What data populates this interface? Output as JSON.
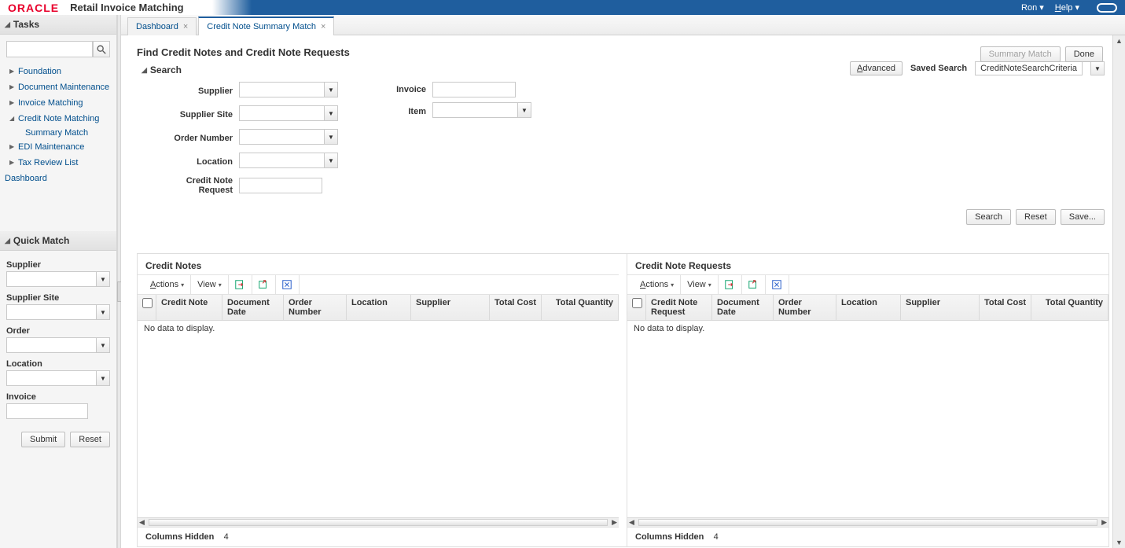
{
  "brand": {
    "logo": "ORACLE",
    "app": "Retail Invoice Matching",
    "user": "Ron",
    "help": "Help"
  },
  "sidebar": {
    "tasks_title": "Tasks",
    "tree": {
      "foundation": "Foundation",
      "doc_maint": "Document Maintenance",
      "inv_match": "Invoice Matching",
      "cn_match": "Credit Note Matching",
      "cn_summary": "Summary Match",
      "edi": "EDI Maintenance",
      "tax": "Tax Review List",
      "dashboard": "Dashboard"
    },
    "quick_match": {
      "title": "Quick Match",
      "supplier": "Supplier",
      "supplier_site": "Supplier Site",
      "order": "Order",
      "location": "Location",
      "invoice": "Invoice",
      "submit": "Submit",
      "reset": "Reset"
    }
  },
  "tabs": {
    "dashboard": "Dashboard",
    "cns": "Credit Note Summary Match"
  },
  "page": {
    "title": "Find Credit Notes and Credit Note Requests",
    "summary_btn": "Summary Match",
    "done_btn": "Done"
  },
  "search": {
    "title": "Search",
    "advanced": "Advanced",
    "advanced_key": "A",
    "saved_label": "Saved Search",
    "saved_value": "CreditNoteSearchCriteria",
    "fields": {
      "supplier": "Supplier",
      "supplier_site": "Supplier Site",
      "order_no": "Order Number",
      "location": "Location",
      "cnr": "Credit Note Request",
      "invoice": "Invoice",
      "item": "Item"
    },
    "buttons": {
      "search": "Search",
      "reset": "Reset",
      "save": "Save..."
    }
  },
  "toolbar": {
    "actions": "Actions",
    "actions_key": "A",
    "view": "View"
  },
  "panes": {
    "left": {
      "title": "Credit Notes",
      "cols": {
        "cn": "Credit Note",
        "doc_date": "Document Date",
        "order": "Order Number",
        "location": "Location",
        "supplier": "Supplier",
        "total_cost": "Total Cost",
        "total_qty": "Total Quantity"
      },
      "empty": "No data to display.",
      "hidden_label": "Columns Hidden",
      "hidden_count": "4"
    },
    "right": {
      "title": "Credit Note Requests",
      "cols": {
        "cnr": "Credit Note Request",
        "doc_date": "Document Date",
        "order": "Order Number",
        "location": "Location",
        "supplier": "Supplier",
        "total_cost": "Total Cost",
        "total_qty": "Total Quantity"
      },
      "empty": "No data to display.",
      "hidden_label": "Columns Hidden",
      "hidden_count": "4"
    }
  }
}
